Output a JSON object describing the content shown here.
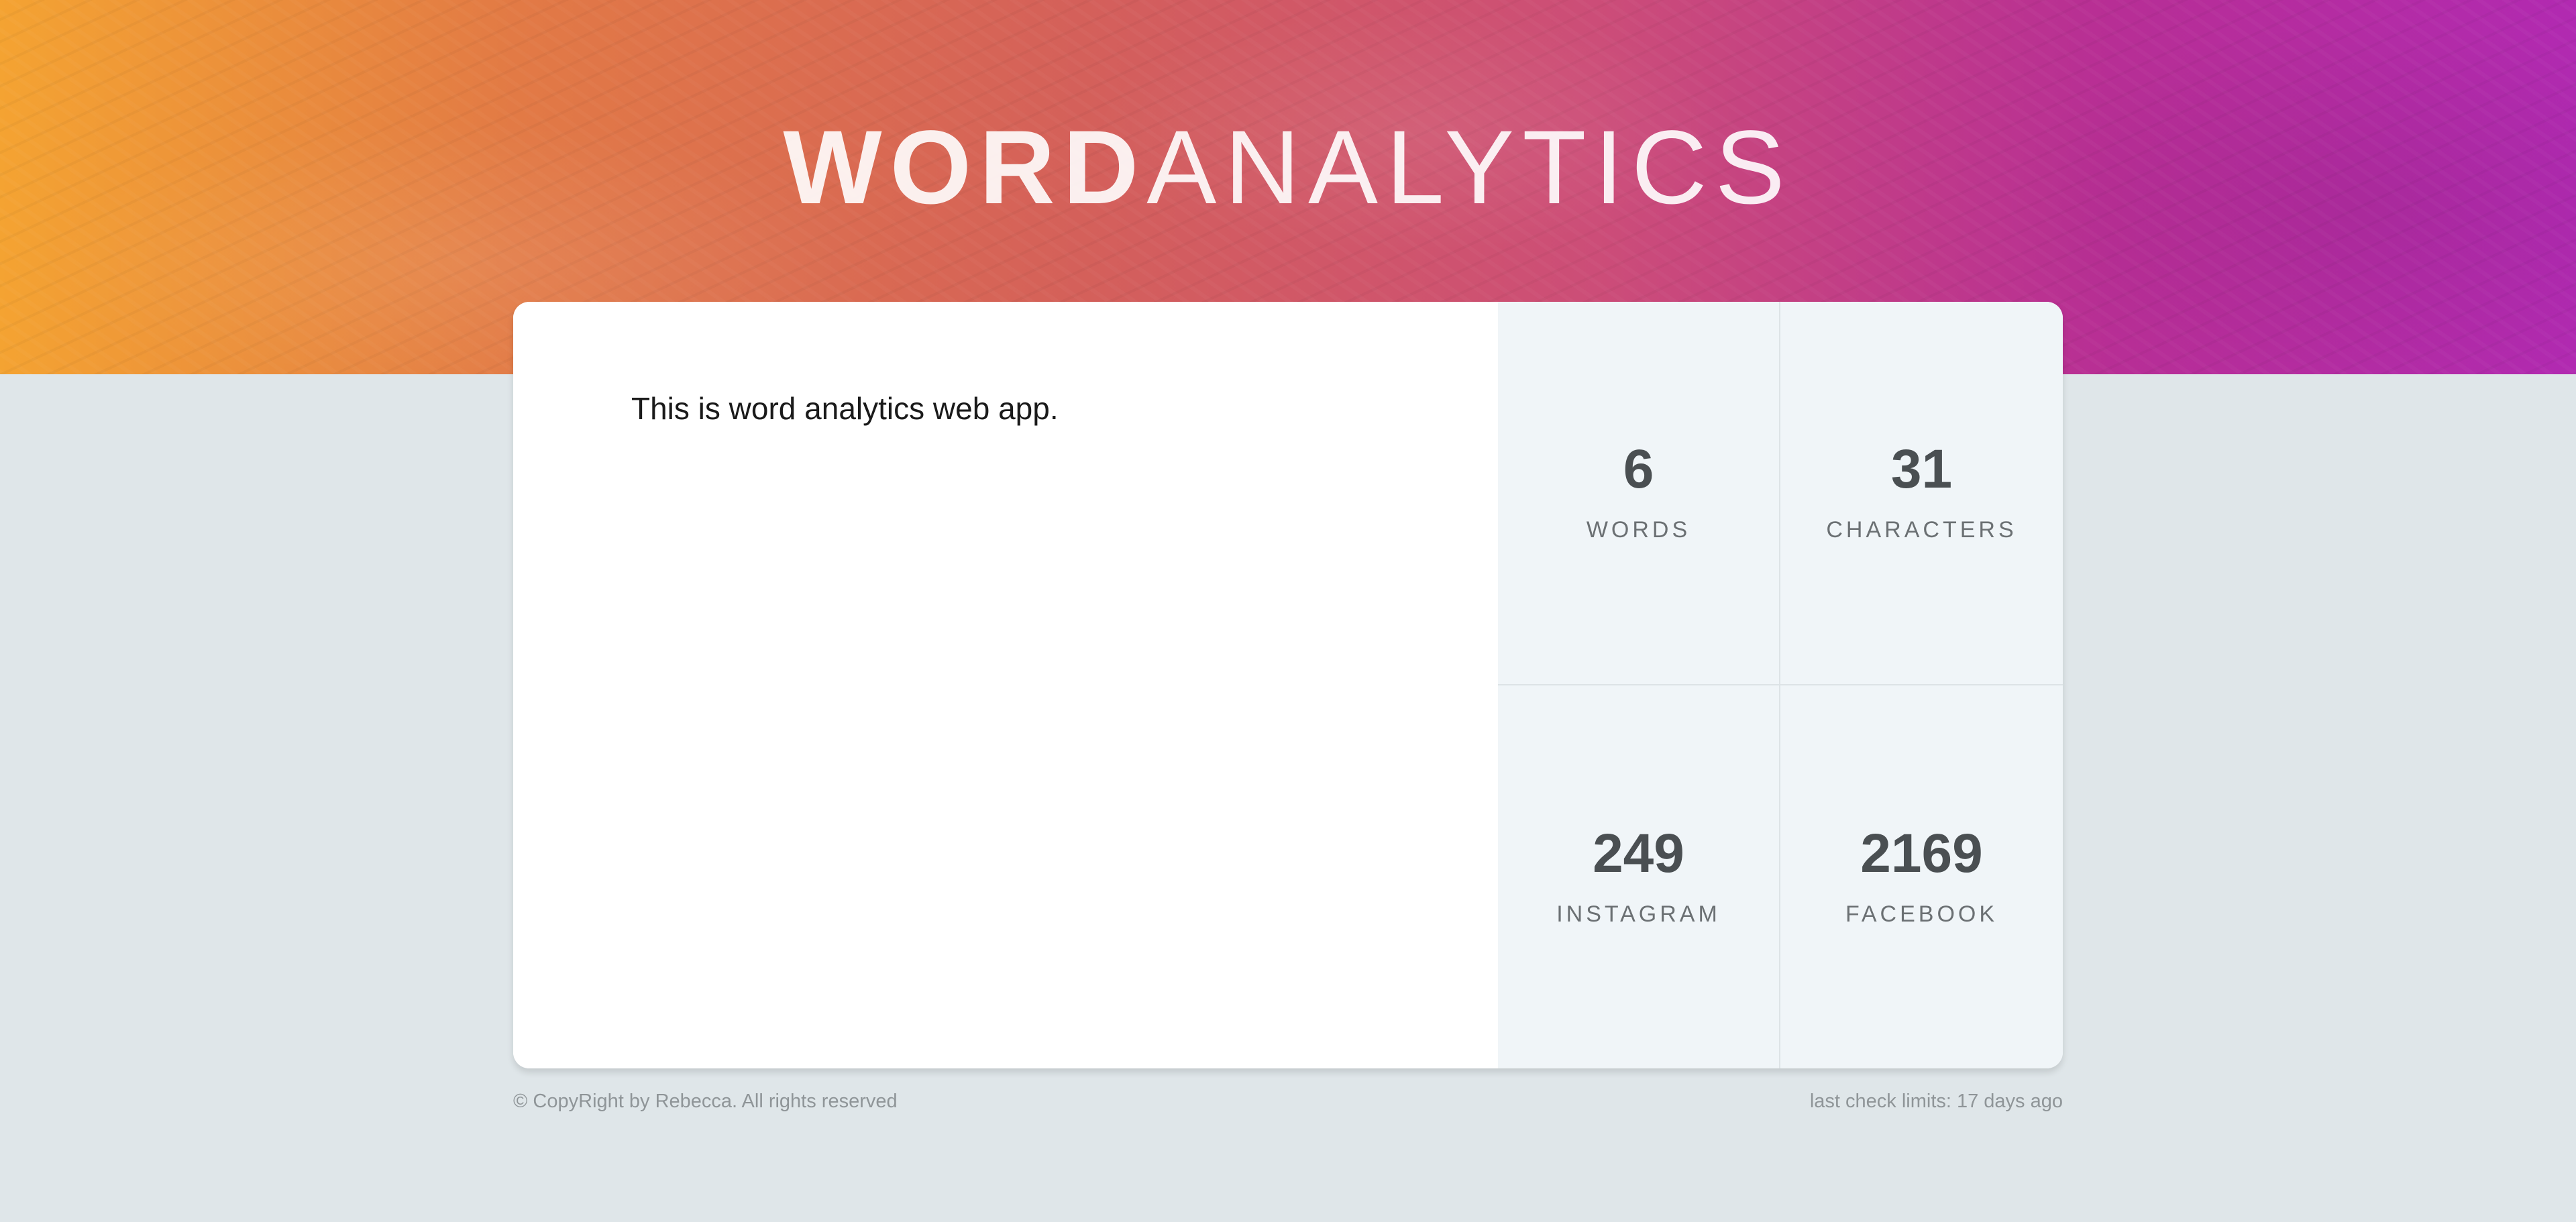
{
  "header": {
    "title_bold": "WORD",
    "title_light": "ANALYTICS",
    "gradient_colors": [
      "#f4a332",
      "#d4605a",
      "#b12ab1"
    ]
  },
  "editor": {
    "value": "This is word analytics web app.",
    "placeholder": ""
  },
  "stats": [
    {
      "value": "6",
      "label": "WORDS"
    },
    {
      "value": "31",
      "label": "CHARACTERS"
    },
    {
      "value": "249",
      "label": "INSTAGRAM"
    },
    {
      "value": "2169",
      "label": "FACEBOOK"
    }
  ],
  "footer": {
    "copyright": "© CopyRight by Rebecca. All rights reserved",
    "last_check": "last check limits: 17 days ago"
  },
  "colors": {
    "page_background": "#dfe6e9",
    "stats_background": "#f0f5f8",
    "stat_number": "#4a4f52"
  }
}
